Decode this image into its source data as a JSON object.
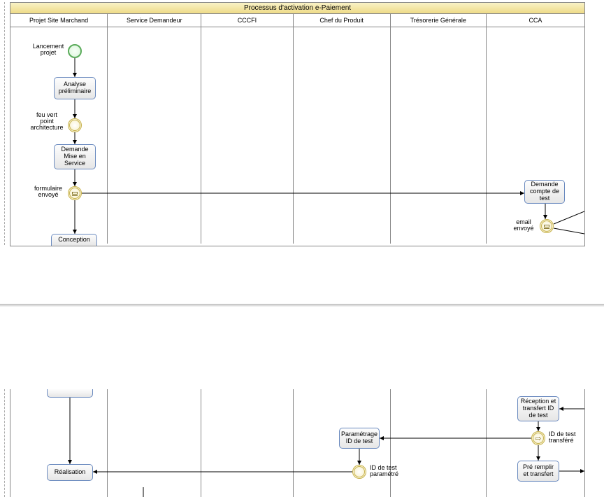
{
  "pool": {
    "title": "Processus d'activation e-Paiement",
    "lanes": [
      {
        "id": "l1",
        "name": "Projet Site Marchand",
        "width": 138
      },
      {
        "id": "l2",
        "name": "Service Demandeur",
        "width": 133
      },
      {
        "id": "l3",
        "name": "CCCFI",
        "width": 130
      },
      {
        "id": "l4",
        "name": "Chef du Produit",
        "width": 138
      },
      {
        "id": "l5",
        "name": "Trésorerie Générale",
        "width": 136
      },
      {
        "id": "l6",
        "name": "CCA",
        "width": 133
      }
    ]
  },
  "top": {
    "events": {
      "start": "Lancement projet",
      "feu_vert": "feu vert point architecture",
      "formulaire": "formulaire envoyé",
      "email": "email envoyé"
    },
    "tasks": {
      "analyse": "Analyse préliminaire",
      "demande_mes": "Demande Mise en Service",
      "demande_compte": "Demande compte de test",
      "conception": "Conception"
    }
  },
  "bottom": {
    "tasks": {
      "blank_left": " ",
      "realisation": "Réalisation",
      "param_id": "Paramétrage ID de test",
      "reception_id": "Réception et transfert ID de test",
      "pre_remplir": "Pré remplir et transfert"
    },
    "events": {
      "id_transfere": "ID de test transféré",
      "id_parametre": "ID de test paramétré"
    }
  }
}
